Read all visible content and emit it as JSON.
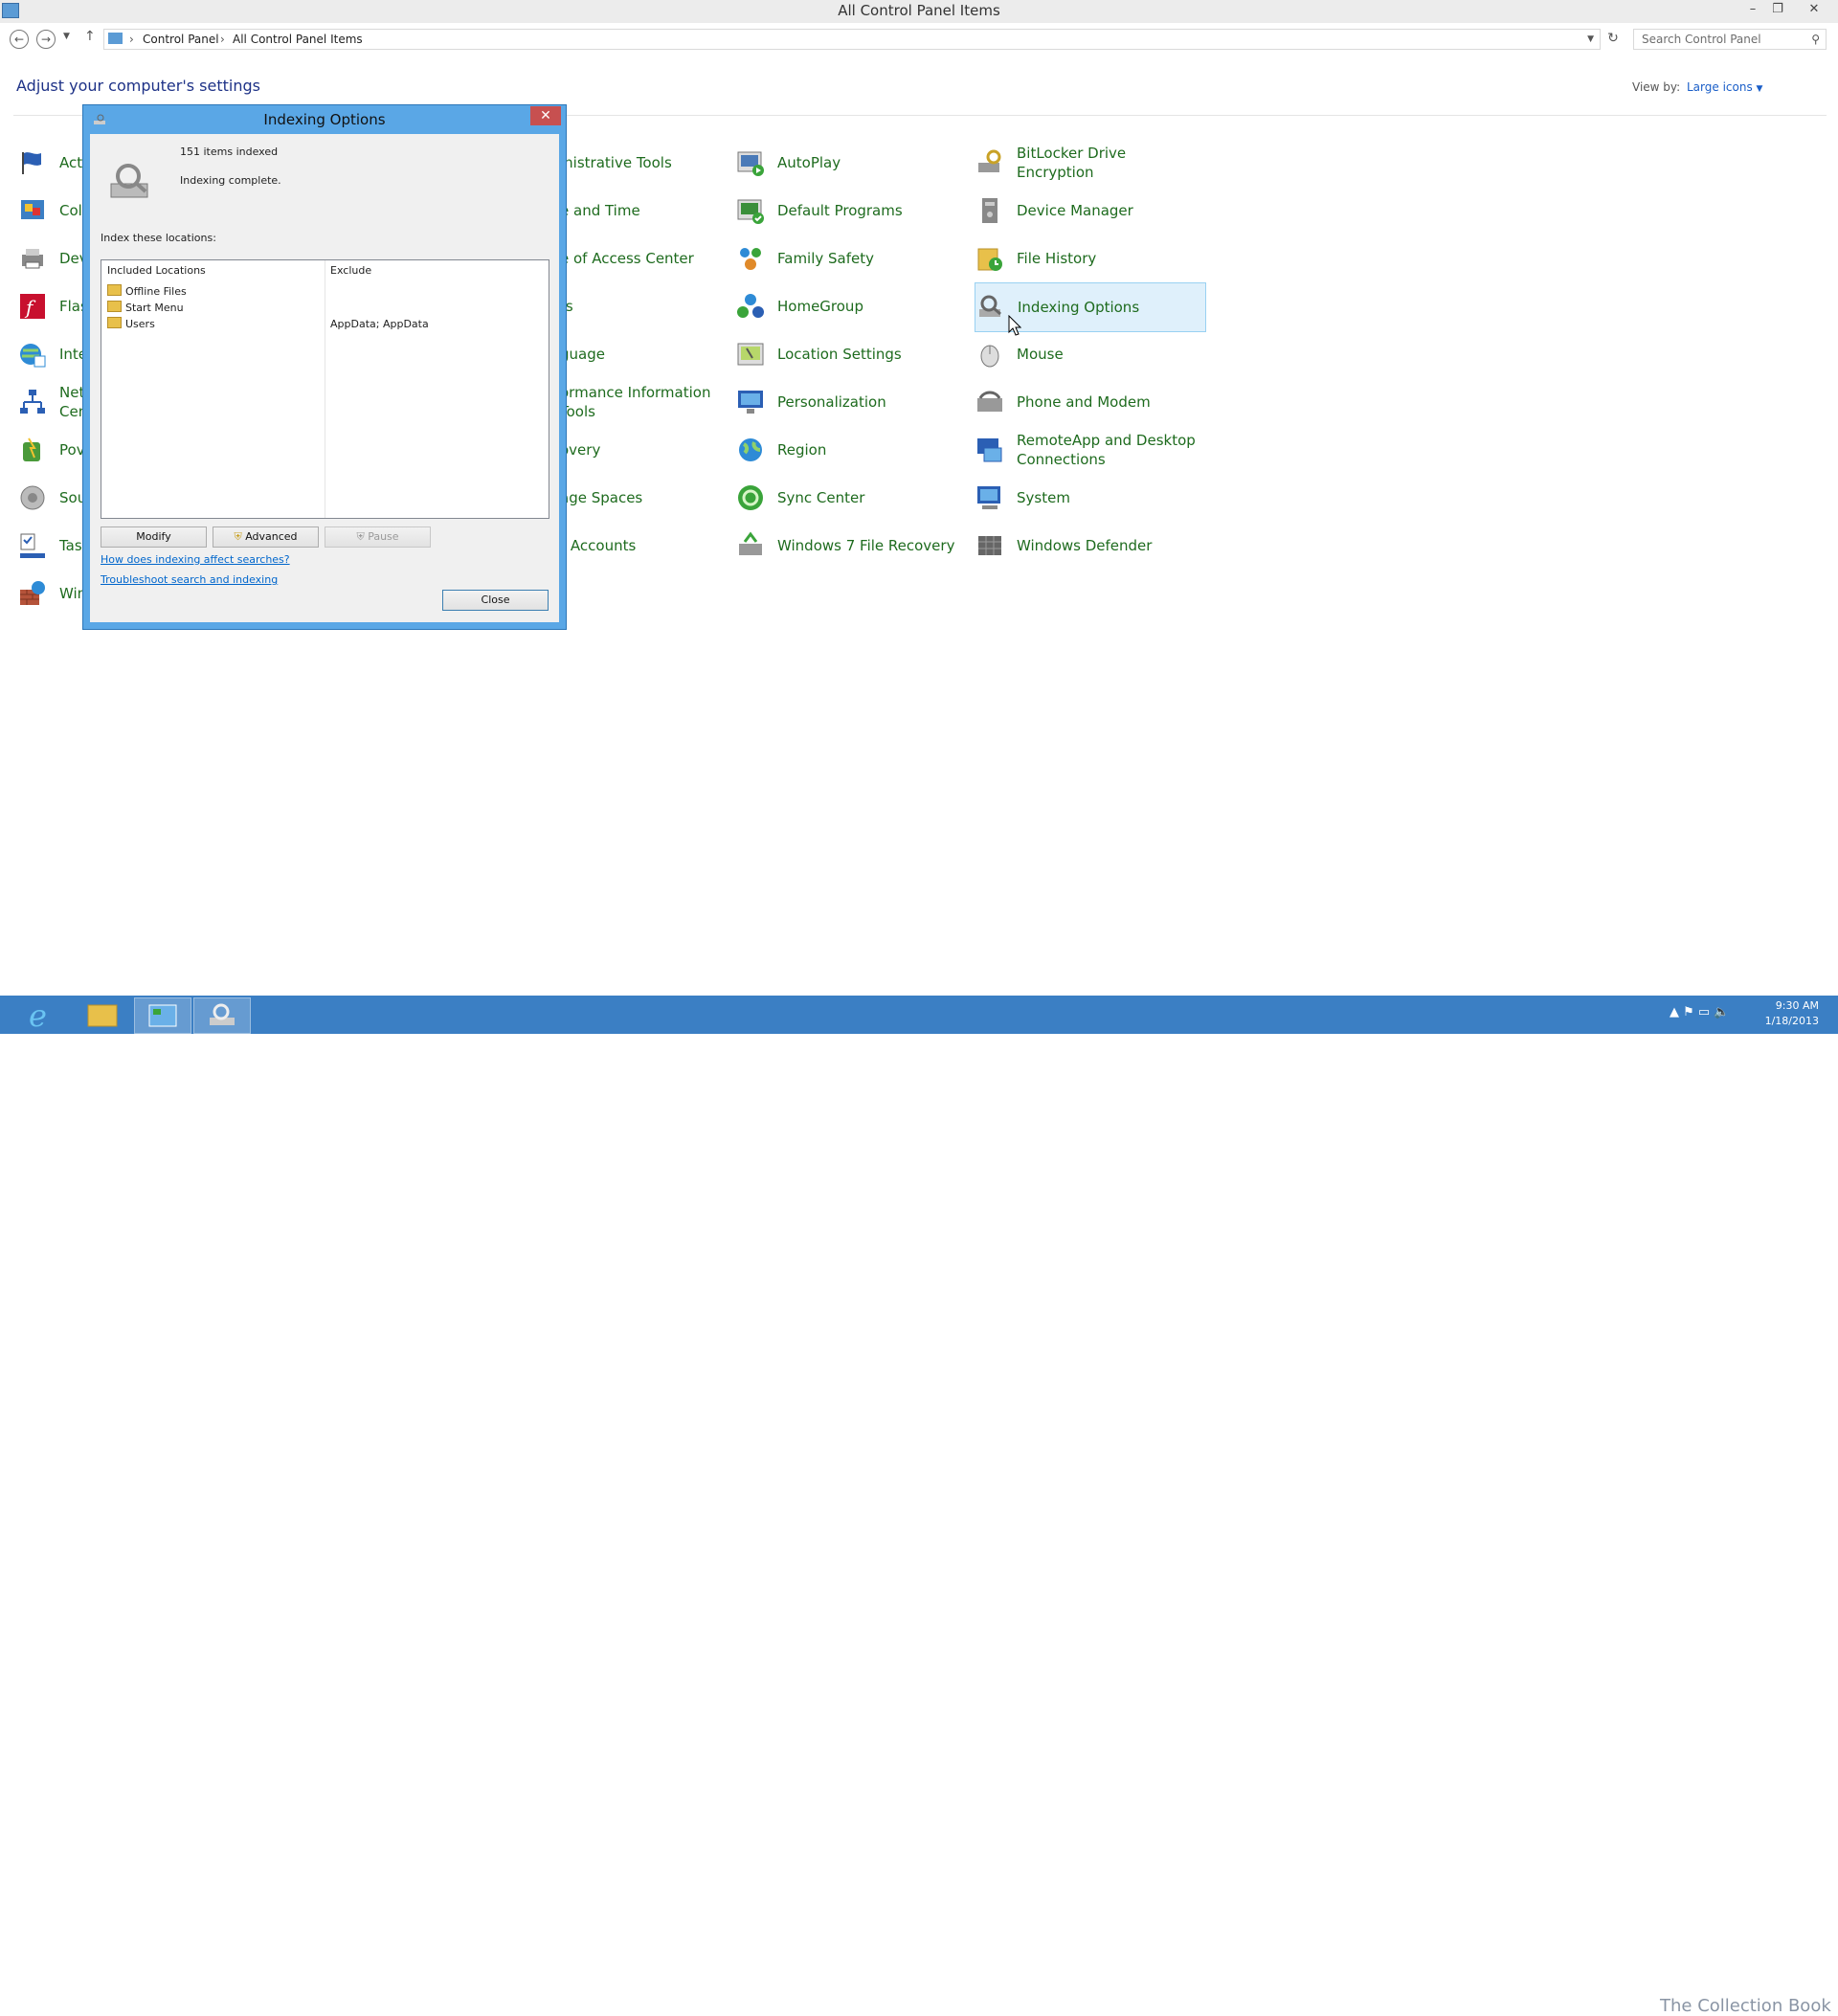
{
  "window": {
    "title": "All Control Panel Items"
  },
  "address": {
    "crumbs": [
      "Control Panel",
      "All Control Panel Items"
    ],
    "search_placeholder": "Search Control Panel"
  },
  "header": {
    "heading": "Adjust your computer's settings",
    "view_by_label": "View by:",
    "view_by_value": "Large icons"
  },
  "items": [
    {
      "label": "Acti",
      "icon": "flag-icon"
    },
    {
      "label": "Col",
      "icon": "color-icon"
    },
    {
      "label": "Dev",
      "icon": "devices-icon"
    },
    {
      "label": "Flas",
      "icon": "flash-icon"
    },
    {
      "label": "Inte",
      "icon": "internet-icon"
    },
    {
      "label": "Net\nCen",
      "icon": "network-icon"
    },
    {
      "label": "Pov",
      "icon": "power-icon"
    },
    {
      "label": "Sou",
      "icon": "sound-icon"
    },
    {
      "label": "Tas",
      "icon": "taskbar-icon"
    },
    {
      "label": "Win",
      "icon": "firewall-icon"
    },
    {
      "label": "inistrative Tools"
    },
    {
      "label": "e and Time"
    },
    {
      "label": "e of Access Center"
    },
    {
      "label": "ts"
    },
    {
      "label": "guage"
    },
    {
      "label": "ormance Information\nTools"
    },
    {
      "label": "overy"
    },
    {
      "label": "age Spaces"
    },
    {
      "label": "r Accounts"
    },
    {
      "label": "AutoPlay",
      "icon": "autoplay-icon"
    },
    {
      "label": "Default Programs",
      "icon": "default-programs-icon"
    },
    {
      "label": "Family Safety",
      "icon": "family-safety-icon"
    },
    {
      "label": "HomeGroup",
      "icon": "homegroup-icon"
    },
    {
      "label": "Location Settings",
      "icon": "location-icon"
    },
    {
      "label": "Personalization",
      "icon": "personalization-icon"
    },
    {
      "label": "Region",
      "icon": "region-icon"
    },
    {
      "label": "Sync Center",
      "icon": "sync-icon"
    },
    {
      "label": "Windows 7 File Recovery",
      "icon": "file-recovery-icon"
    },
    {
      "label": "BitLocker Drive Encryption",
      "icon": "bitlocker-icon"
    },
    {
      "label": "Device Manager",
      "icon": "device-manager-icon"
    },
    {
      "label": "File History",
      "icon": "file-history-icon"
    },
    {
      "label": "Indexing Options",
      "icon": "indexing-icon"
    },
    {
      "label": "Mouse",
      "icon": "mouse-icon"
    },
    {
      "label": "Phone and Modem",
      "icon": "phone-icon"
    },
    {
      "label": "RemoteApp and Desktop\nConnections",
      "icon": "remoteapp-icon"
    },
    {
      "label": "System",
      "icon": "system-icon"
    },
    {
      "label": "Windows Defender",
      "icon": "defender-icon"
    }
  ],
  "dialog": {
    "title": "Indexing Options",
    "count_text": "151 items indexed",
    "status_text": "Indexing complete.",
    "locations_label": "Index these locations:",
    "columns": [
      "Included Locations",
      "Exclude"
    ],
    "rows": [
      {
        "location": "Offline Files",
        "exclude": ""
      },
      {
        "location": "Start Menu",
        "exclude": ""
      },
      {
        "location": "Users",
        "exclude": "AppData; AppData"
      }
    ],
    "modify_label": "Modify",
    "advanced_label": "Advanced",
    "pause_label": "Pause",
    "link1": "How does indexing affect searches?",
    "link2": "Troubleshoot search and indexing",
    "close_label": "Close"
  },
  "taskbar": {
    "time": "9:30 AM",
    "date": "1/18/2013",
    "watermark": "The Collection Book"
  },
  "colors": {
    "link_green": "#1e6b1e",
    "heading_blue": "#1e3287",
    "dialog_frame": "#5aa7e6",
    "taskbar": "#3b7fc4",
    "selected_item": "#dff0fb"
  }
}
